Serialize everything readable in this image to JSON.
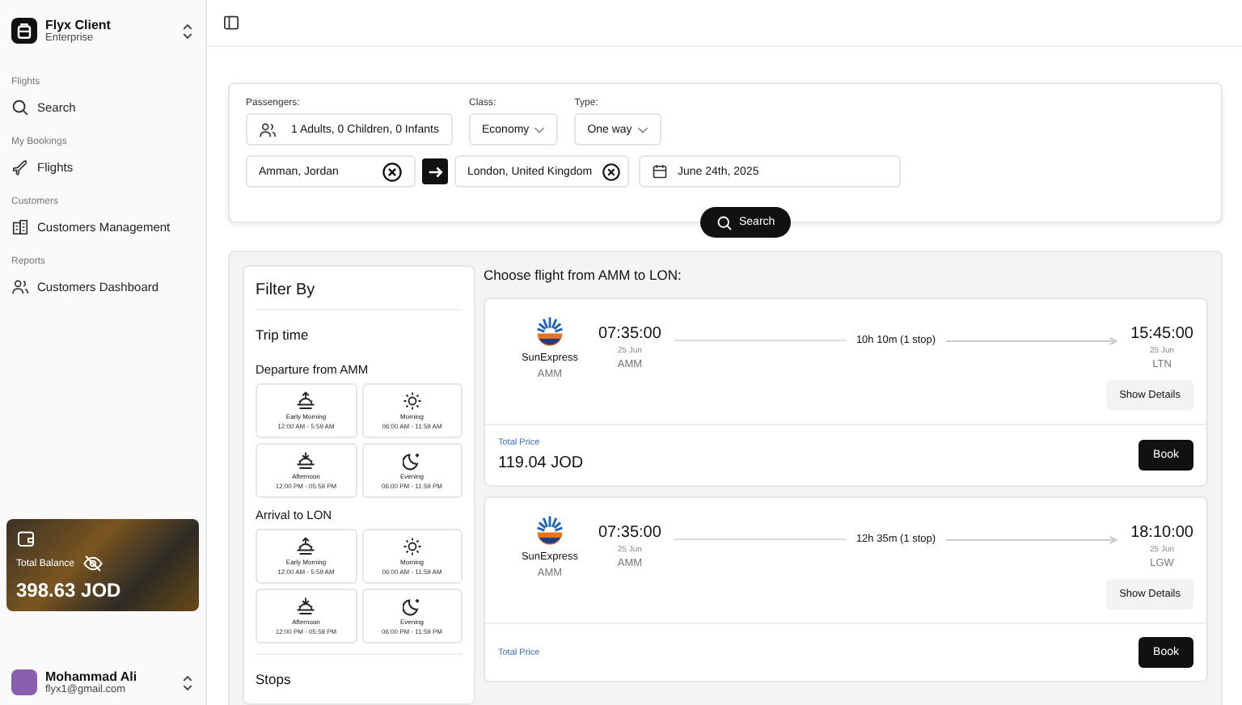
{
  "sidebar": {
    "workspace": {
      "name": "Flyx Client",
      "plan": "Enterprise"
    },
    "sections": [
      {
        "heading": "Flights",
        "items": [
          {
            "label": "Search",
            "kind": "search"
          }
        ]
      },
      {
        "heading": "My Bookings",
        "items": [
          {
            "label": "Flights",
            "kind": "flights"
          }
        ]
      },
      {
        "heading": "Customers",
        "items": [
          {
            "label": "Customers Management",
            "kind": "management"
          }
        ]
      },
      {
        "heading": "Reports",
        "items": [
          {
            "label": "Customers Dashboard",
            "kind": "dashboard"
          }
        ]
      }
    ],
    "balance": {
      "label": "Total Balance",
      "amount": "398.63 JOD"
    },
    "user": {
      "name": "Mohammad Ali",
      "email": "flyx1@gmail.com"
    }
  },
  "search_form": {
    "passengers": {
      "label": "Passengers:",
      "value": "1 Adults, 0 Children, 0 Infants"
    },
    "class": {
      "label": "Class:",
      "value": "Economy"
    },
    "type": {
      "label": "Type:",
      "value": "One way"
    },
    "origin": "Amman, Jordan",
    "destination": "London, United Kingdom",
    "date": "June 24th, 2025",
    "search_button": "Search"
  },
  "filters": {
    "title": "Filter By",
    "section": "Trip time",
    "groups": [
      {
        "title": "Departure from AMM",
        "slots": [
          {
            "kind": "early-morning",
            "name": "Early Morning",
            "range": "12:00 AM - 5:59 AM"
          },
          {
            "kind": "morning",
            "name": "Morning",
            "range": "06:00 AM - 11:59 AM"
          },
          {
            "kind": "afternoon",
            "name": "Afternoon",
            "range": "12:00 PM - 05:59 PM"
          },
          {
            "kind": "evening",
            "name": "Evening",
            "range": "06:00 PM - 11:59 PM"
          }
        ]
      },
      {
        "title": "Arrival to LON",
        "slots": [
          {
            "kind": "early-morning",
            "name": "Early Morning",
            "range": "12:00 AM - 5:59 AM"
          },
          {
            "kind": "morning",
            "name": "Morning",
            "range": "06:00 AM - 11:59 AM"
          },
          {
            "kind": "afternoon",
            "name": "Afternoon",
            "range": "12:00 PM - 05:59 PM"
          },
          {
            "kind": "evening",
            "name": "Evening",
            "range": "06:00 PM - 11:59 PM"
          }
        ]
      }
    ],
    "next_section": "Stops"
  },
  "results": {
    "title": "Choose flight from AMM to LON:",
    "flights": [
      {
        "airline": "SunExpress",
        "airline_code": "AMM",
        "departure": {
          "time": "07:35:00",
          "date": "25 Jun",
          "airport": "AMM"
        },
        "duration": "10h 10m (1 stop)",
        "arrival": {
          "time": "15:45:00",
          "date": "25 Jun",
          "airport": "LTN"
        },
        "details_button": "Show Details",
        "price_label": "Total Price",
        "price": "119.04 JOD",
        "book_button": "Book"
      },
      {
        "airline": "SunExpress",
        "airline_code": "AMM",
        "departure": {
          "time": "07:35:00",
          "date": "25 Jun",
          "airport": "AMM"
        },
        "duration": "12h 35m (1 stop)",
        "arrival": {
          "time": "18:10:00",
          "date": "25 Jun",
          "airport": "LGW"
        },
        "details_button": "Show Details",
        "price_label": "Total Price",
        "book_button": "Book"
      }
    ]
  }
}
